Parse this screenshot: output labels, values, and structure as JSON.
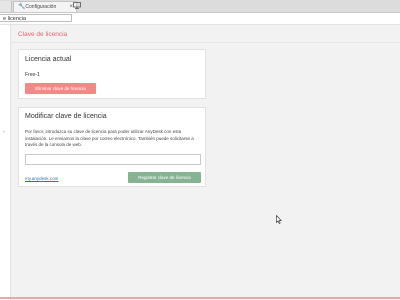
{
  "tabs": {
    "config_label": "Configuración",
    "close_glyph": "×"
  },
  "address_bar": {
    "text": "e licencia"
  },
  "page": {
    "title": "Clave de licencia"
  },
  "current_license": {
    "heading": "Licencia actual",
    "value": "Free-1",
    "remove_button": "Eliminar clave de licencia"
  },
  "modify_license": {
    "heading": "Modificar clave de licencia",
    "description": "Por favor, introduzca su clave de licencia para poder utilizar AnyDesk con esta instalación. Le enviamos la clave por correo electrónico. También puede solicitarse a través de la consola de web.",
    "input_value": "",
    "input_placeholder": "",
    "link_text": "my.anydesk.com",
    "register_button": "Registrar clave de licencia"
  },
  "colors": {
    "accent_red": "#e0686a",
    "remove_button": "#f08a86",
    "register_button": "#86b493",
    "link": "#2f6fb3"
  },
  "icons": {
    "config_tab_icon": "wrench-icon",
    "screen_tab_icon": "monitor-icon",
    "cursor": "mouse-pointer-icon"
  }
}
